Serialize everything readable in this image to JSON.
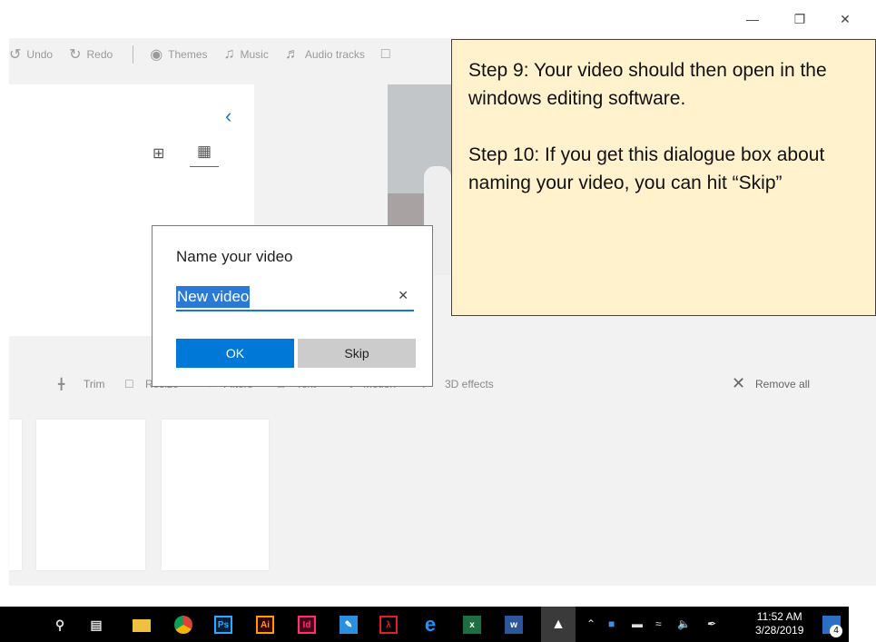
{
  "window": {
    "minimize_icon": "minimize-icon",
    "restore_icon": "restore-icon",
    "close_icon": "close-icon"
  },
  "toolbar": {
    "undo": "Undo",
    "redo": "Redo",
    "themes": "Themes",
    "music": "Music",
    "audio_tracks": "Audio tracks"
  },
  "storyboard": {
    "trim": "Trim",
    "resize": "Resize",
    "filters": "Filters",
    "text": "Text",
    "motion": "Motion",
    "effects_3d": "3D effects",
    "remove_all": "Remove all"
  },
  "dialog": {
    "title": "Name your video",
    "input_value": "New video",
    "ok_label": "OK",
    "skip_label": "Skip"
  },
  "note": {
    "step9": "Step 9: Your video should then open in the windows editing software.",
    "step10": "Step 10: If you get this dialogue box about naming your video, you can hit “Skip”"
  },
  "taskbar": {
    "apps": [
      "Ps",
      "Ai",
      "Id",
      "x",
      "w"
    ],
    "time": "11:52 AM",
    "date": "3/28/2019",
    "notification_count": "4"
  }
}
